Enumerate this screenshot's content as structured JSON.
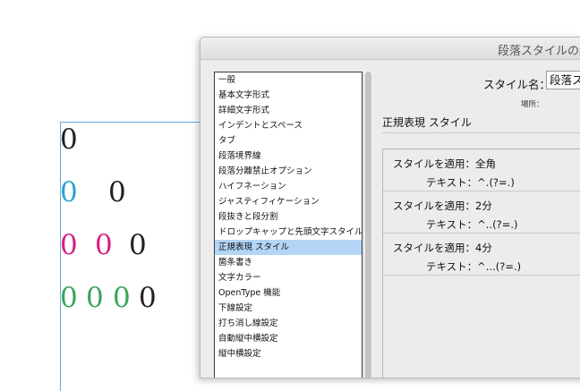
{
  "document": {
    "glyphs": [
      {
        "text": "0",
        "color": "#222222"
      },
      {
        "text": "0",
        "color": "#2aa3cf"
      },
      {
        "text": "0",
        "color": "#222222"
      },
      {
        "text": "0",
        "color": "#d61f86"
      },
      {
        "text": "0",
        "color": "#d61f86"
      },
      {
        "text": "0",
        "color": "#222222"
      },
      {
        "text": "0",
        "color": "#3aa55a"
      },
      {
        "text": "0",
        "color": "#3aa55a"
      },
      {
        "text": "0",
        "color": "#3aa55a"
      },
      {
        "text": "0",
        "color": "#222222"
      }
    ]
  },
  "dialog": {
    "title": "段落スタイルの編",
    "style_name_label": "スタイル名：",
    "style_name_value": "段落ス",
    "location_label": "場所：",
    "section_title": "正規表現 スタイル",
    "categories": [
      "一般",
      "基本文字形式",
      "詳細文字形式",
      "インデントとスペース",
      "タブ",
      "段落境界線",
      "段落分離禁止オプション",
      "ハイフネーション",
      "ジャスティフィケーション",
      "段抜きと段分割",
      "ドロップキャップと先頭文字スタイル",
      "正規表現 スタイル",
      "箇条書き",
      "文字カラー",
      "OpenType 機能",
      "下線設定",
      "打ち消し線設定",
      "自動縦中横設定",
      "縦中横設定"
    ],
    "selected_category": "正規表現 スタイル",
    "grep_rules": [
      {
        "apply_label": "スタイルを適用：全角",
        "text_label": "テキスト：^.(?=.)"
      },
      {
        "apply_label": "スタイルを適用：2分",
        "text_label": "テキスト：^..(?=.)"
      },
      {
        "apply_label": "スタイルを適用：4分",
        "text_label": "テキスト：^...(?=.)"
      }
    ]
  }
}
